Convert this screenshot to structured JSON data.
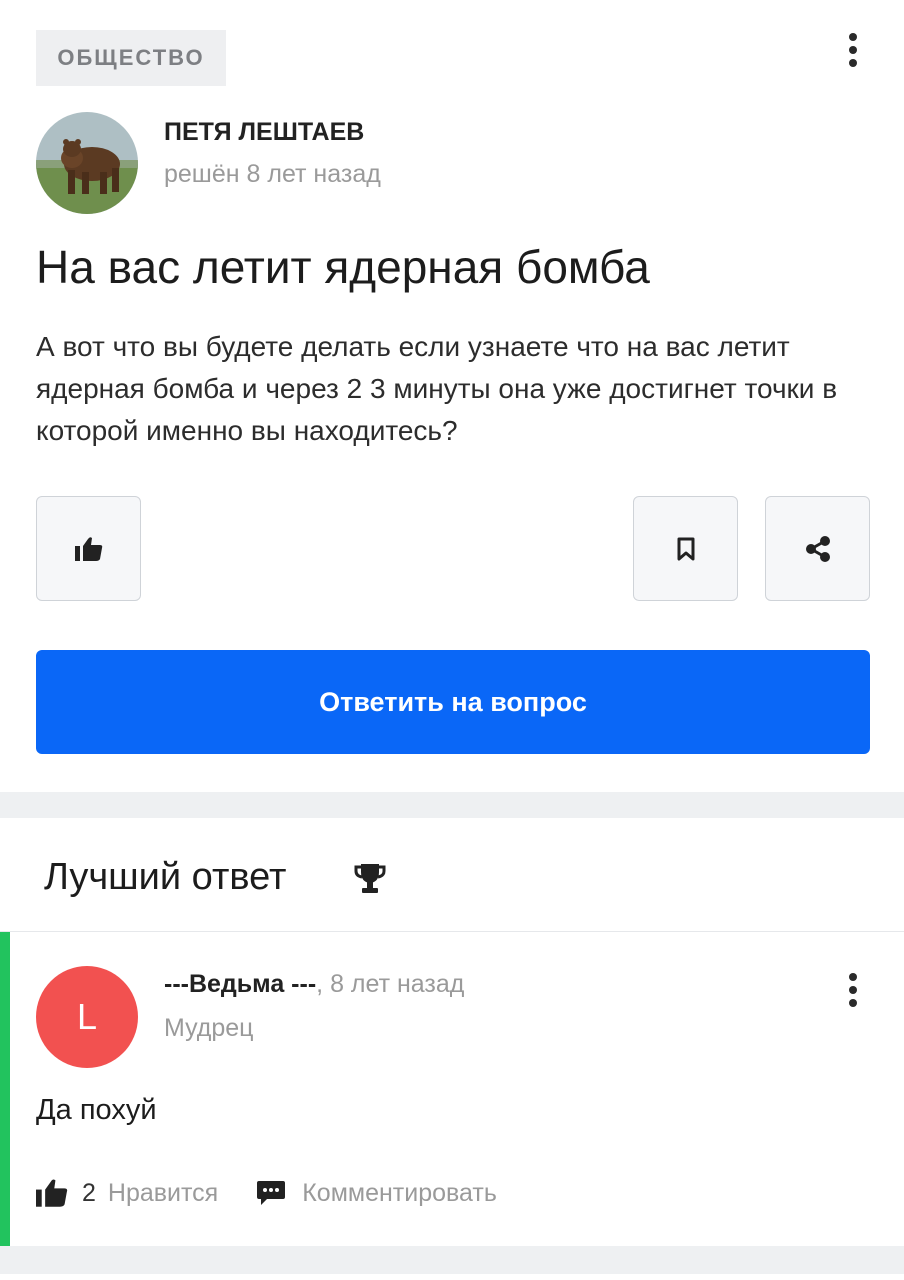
{
  "question": {
    "category": "ОБЩЕСТВО",
    "author_name": "ПЕТЯ ЛЕШТАЕВ",
    "author_meta": "решён 8 лет назад",
    "title": "На вас летит ядерная бомба",
    "body": "А вот что вы будете делать если узнаете что на вас летит ядерная бомба и через 2 3 минуты она уже достигнет точки в которой именно вы находитесь?",
    "answer_button": "Ответить на вопрос"
  },
  "best_answer": {
    "section_title": "Лучший ответ",
    "avatar_letter": "L",
    "author_name": "---Ведьма ---",
    "time": ", 8 лет назад",
    "rank": "Мудрец",
    "text": "Да похуй",
    "likes_count": "2",
    "likes_label": "Нравится",
    "comment_label": "Комментировать"
  },
  "icons": [
    "more-vertical-icon",
    "thumbs-up-icon",
    "bookmark-icon",
    "share-icon",
    "trophy-icon",
    "comment-icon"
  ],
  "colors": {
    "primary": "#0a67f7",
    "best_answer_accent": "#22c35e",
    "avatar_l": "#f25150",
    "muted_text": "#9a9a9a",
    "page_bg": "#eef0f2"
  }
}
